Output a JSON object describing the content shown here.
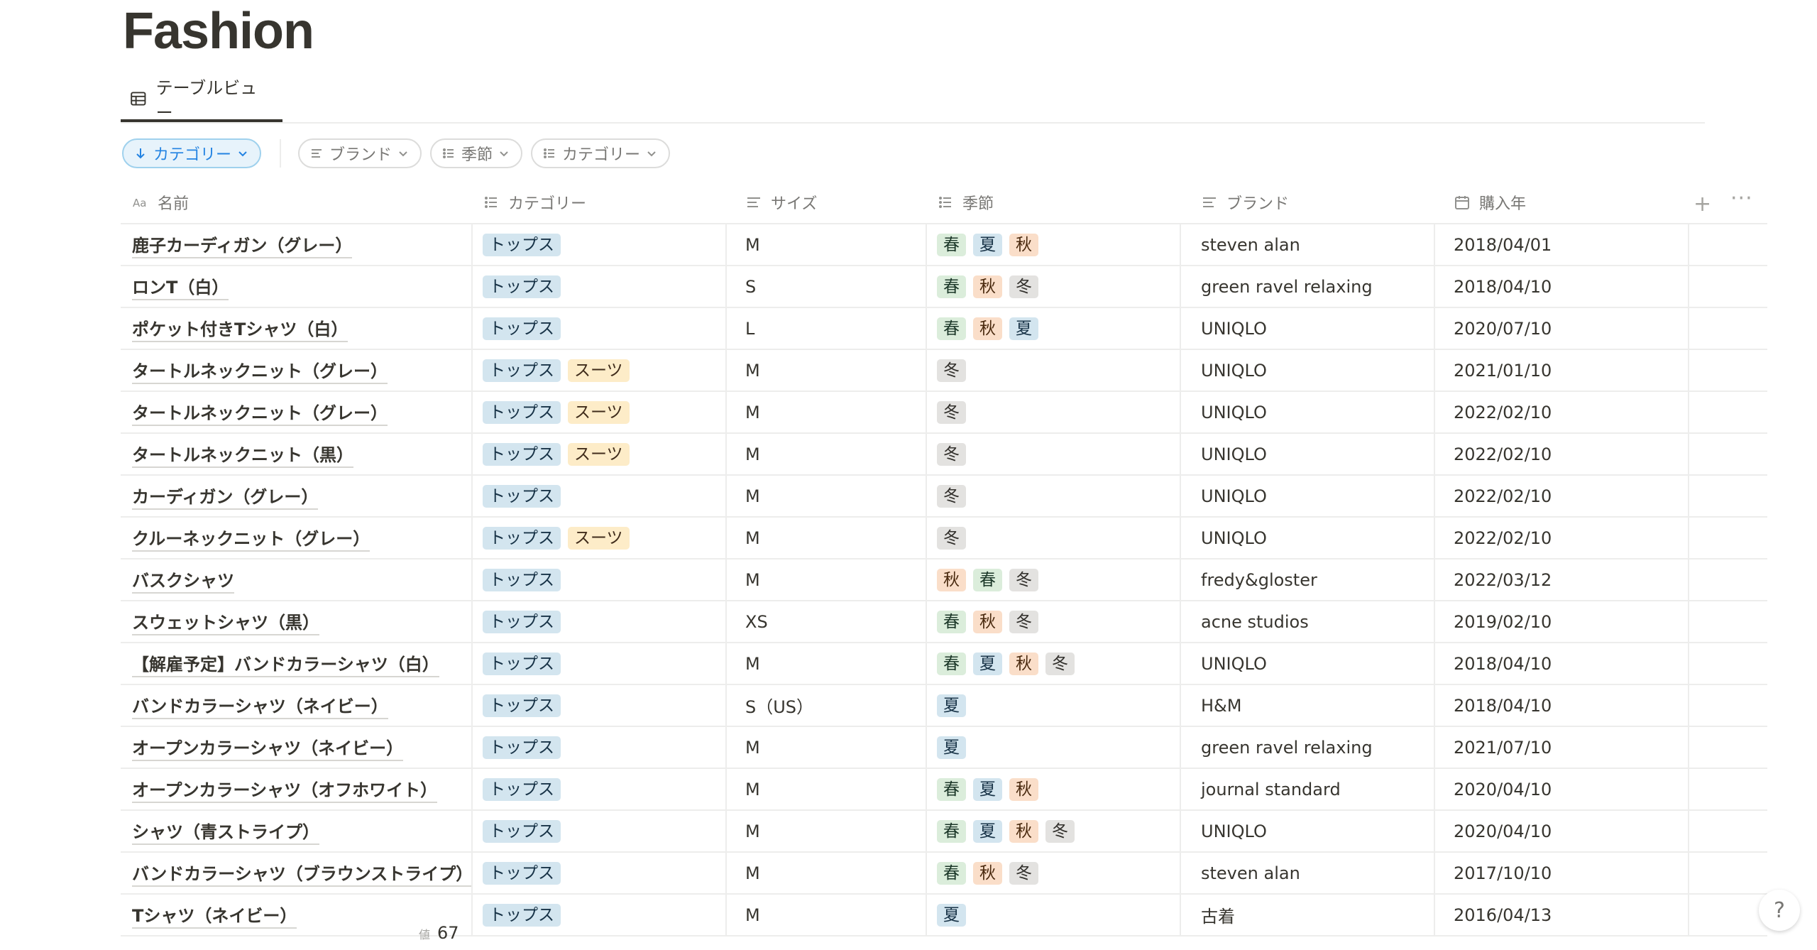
{
  "page": {
    "title": "Fashion"
  },
  "view_tab": {
    "label": "テーブルビュー"
  },
  "filters": {
    "sort_label": "カテゴリー",
    "chips": [
      {
        "label": "ブランド",
        "icon": "text-icon"
      },
      {
        "label": "季節",
        "icon": "list-icon"
      },
      {
        "label": "カテゴリー",
        "icon": "list-icon"
      }
    ]
  },
  "columns": {
    "name": "名前",
    "category": "カテゴリー",
    "size": "サイズ",
    "season": "季節",
    "brand": "ブランド",
    "purchase_year": "購入年",
    "add": "+",
    "more": "···"
  },
  "tag_colors": {
    "トップス": "#d3e5ef",
    "スーツ": "#fdecc8",
    "春": "#dbeddb",
    "夏": "#d3e5ef",
    "秋": "#fadec9",
    "冬": "#e3e2e0"
  },
  "rows": [
    {
      "name": "鹿子カーディガン（グレー）",
      "category": [
        "トップス"
      ],
      "size": "M",
      "season": [
        "春",
        "夏",
        "秋"
      ],
      "brand": "steven alan",
      "date": "2018/04/01"
    },
    {
      "name": "ロンT（白）",
      "category": [
        "トップス"
      ],
      "size": "S",
      "season": [
        "春",
        "秋",
        "冬"
      ],
      "brand": "green ravel relaxing",
      "date": "2018/04/10"
    },
    {
      "name": "ポケット付きTシャツ（白）",
      "category": [
        "トップス"
      ],
      "size": "L",
      "season": [
        "春",
        "秋",
        "夏"
      ],
      "brand": "UNIQLO",
      "date": "2020/07/10"
    },
    {
      "name": "タートルネックニット（グレー）",
      "category": [
        "トップス",
        "スーツ"
      ],
      "size": "M",
      "season": [
        "冬"
      ],
      "brand": "UNIQLO",
      "date": "2021/01/10"
    },
    {
      "name": "タートルネックニット（グレー）",
      "category": [
        "トップス",
        "スーツ"
      ],
      "size": "M",
      "season": [
        "冬"
      ],
      "brand": "UNIQLO",
      "date": "2022/02/10"
    },
    {
      "name": "タートルネックニット（黒）",
      "category": [
        "トップス",
        "スーツ"
      ],
      "size": "M",
      "season": [
        "冬"
      ],
      "brand": "UNIQLO",
      "date": "2022/02/10"
    },
    {
      "name": "カーディガン（グレー）",
      "category": [
        "トップス"
      ],
      "size": "M",
      "season": [
        "冬"
      ],
      "brand": "UNIQLO",
      "date": "2022/02/10"
    },
    {
      "name": "クルーネックニット（グレー）",
      "category": [
        "トップス",
        "スーツ"
      ],
      "size": "M",
      "season": [
        "冬"
      ],
      "brand": "UNIQLO",
      "date": "2022/02/10"
    },
    {
      "name": "バスクシャツ",
      "category": [
        "トップス"
      ],
      "size": "M",
      "season": [
        "秋",
        "春",
        "冬"
      ],
      "brand": "fredy&gloster",
      "date": "2022/03/12"
    },
    {
      "name": "スウェットシャツ（黒）",
      "category": [
        "トップス"
      ],
      "size": "XS",
      "season": [
        "春",
        "秋",
        "冬"
      ],
      "brand": "acne studios",
      "date": "2019/02/10"
    },
    {
      "name": "【解雇予定】バンドカラーシャツ（白）",
      "category": [
        "トップス"
      ],
      "size": "M",
      "season": [
        "春",
        "夏",
        "秋",
        "冬"
      ],
      "brand": "UNIQLO",
      "date": "2018/04/10"
    },
    {
      "name": "バンドカラーシャツ（ネイビー）",
      "category": [
        "トップス"
      ],
      "size": "S（US）",
      "season": [
        "夏"
      ],
      "brand": "H&M",
      "date": "2018/04/10"
    },
    {
      "name": "オープンカラーシャツ（ネイビー）",
      "category": [
        "トップス"
      ],
      "size": "M",
      "season": [
        "夏"
      ],
      "brand": "green ravel relaxing",
      "date": "2021/07/10"
    },
    {
      "name": "オープンカラーシャツ（オフホワイト）",
      "category": [
        "トップス"
      ],
      "size": "M",
      "season": [
        "春",
        "夏",
        "秋"
      ],
      "brand": "journal standard",
      "date": "2020/04/10"
    },
    {
      "name": "シャツ（青ストライプ）",
      "category": [
        "トップス"
      ],
      "size": "M",
      "season": [
        "春",
        "夏",
        "秋",
        "冬"
      ],
      "brand": "UNIQLO",
      "date": "2020/04/10"
    },
    {
      "name": "バンドカラーシャツ（ブラウンストライプ）",
      "category": [
        "トップス"
      ],
      "size": "M",
      "season": [
        "春",
        "秋",
        "冬"
      ],
      "brand": "steven alan",
      "date": "2017/10/10"
    },
    {
      "name": "Tシャツ（ネイビー）",
      "category": [
        "トップス"
      ],
      "size": "M",
      "season": [
        "夏"
      ],
      "brand": "古着",
      "date": "2016/04/13"
    }
  ],
  "footer": {
    "label": "値",
    "count": "67"
  },
  "help": {
    "label": "?"
  }
}
